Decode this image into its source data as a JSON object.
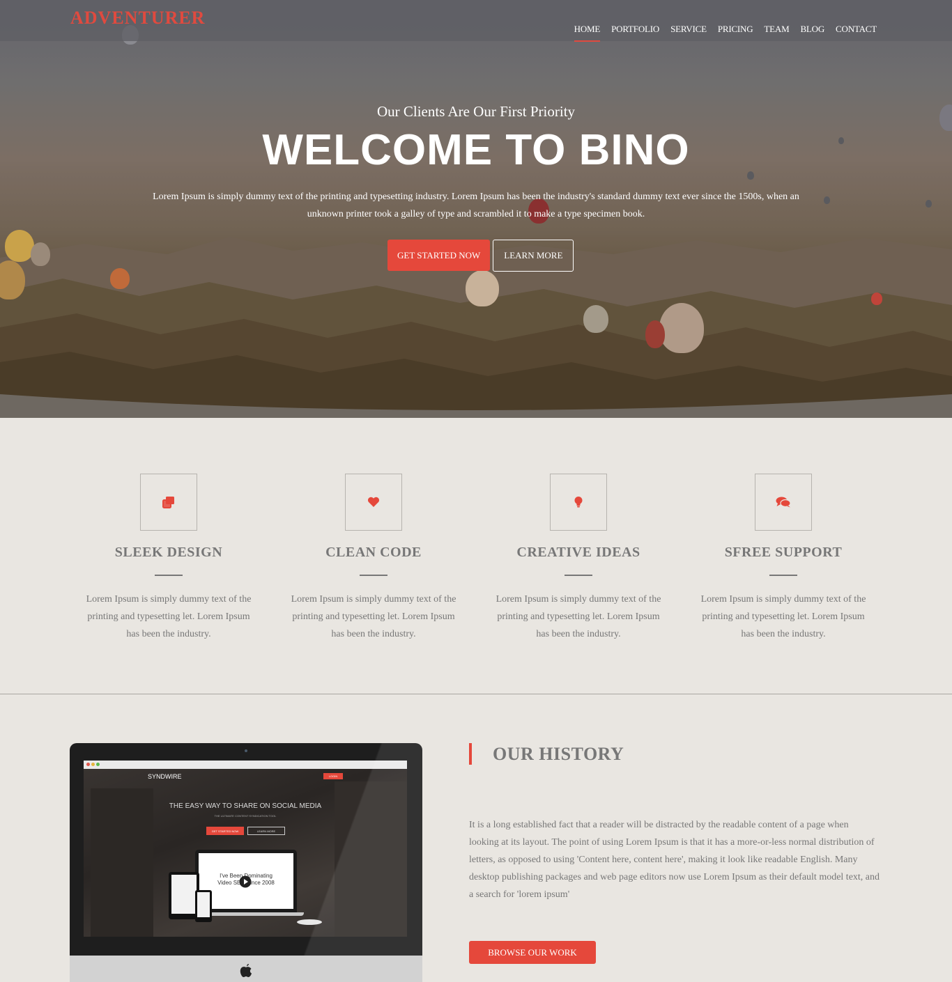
{
  "brand": {
    "logo": "ADVENTURER",
    "accent_color": "#e5483b"
  },
  "nav": {
    "items": [
      "HOME",
      "PORTFOLIO",
      "SERVICE",
      "PRICING",
      "TEAM",
      "BLOG",
      "CONTACT"
    ],
    "active": "HOME"
  },
  "hero": {
    "subtitle": "Our Clients Are Our First Priority",
    "title": "WELCOME TO BINO",
    "text": "Lorem Ipsum is simply dummy text of the printing and typesetting industry. Lorem Ipsum has been the industry's standard dummy text ever since the 1500s, when an unknown printer took a galley of type and scrambled it to make a type specimen book.",
    "primary_button": "GET STARTED NOW",
    "secondary_button": "LEARN MORE"
  },
  "features": [
    {
      "icon": "clone-icon",
      "title": "SLEEK DESIGN",
      "text": "Lorem Ipsum is simply dummy text of the printing and typesetting let. Lorem Ipsum has been the industry."
    },
    {
      "icon": "heart-icon",
      "title": "CLEAN CODE",
      "text": "Lorem Ipsum is simply dummy text of the printing and typesetting let. Lorem Ipsum has been the industry."
    },
    {
      "icon": "lightbulb-icon",
      "title": "CREATIVE IDEAS",
      "text": "Lorem Ipsum is simply dummy text of the printing and typesetting let. Lorem Ipsum has been the industry."
    },
    {
      "icon": "chat-icon",
      "title": "SFREE SUPPORT",
      "text": "Lorem Ipsum is simply dummy text of the printing and typesetting let. Lorem Ipsum has been the industry."
    }
  ],
  "history": {
    "title": "OUR HISTORY",
    "text": "It is a long established fact that a reader will be distracted by the readable content of a page when looking at its layout. The point of using Lorem Ipsum is that it has a more-or-less normal distribution of letters, as opposed to using 'Content here, content here', making it look like readable English. Many desktop publishing packages and web page editors now use Lorem Ipsum as their default model text, and a search for 'lorem ipsum'",
    "button": "BROWSE OUR WORK"
  },
  "monitor_screen": {
    "brand": "SYNDWIRE",
    "login": "LOGIN",
    "headline": "THE EASY WAY TO SHARE ON SOCIAL MEDIA",
    "tagline": "THE ULTIMATE CONTENT SYNDICATION TOOL",
    "btn1": "GET STARTED NOW",
    "btn2": "LEARN MORE",
    "laptop_text_1": "I've Been Dominating",
    "laptop_text_2": "Video SEO Since 2008"
  }
}
